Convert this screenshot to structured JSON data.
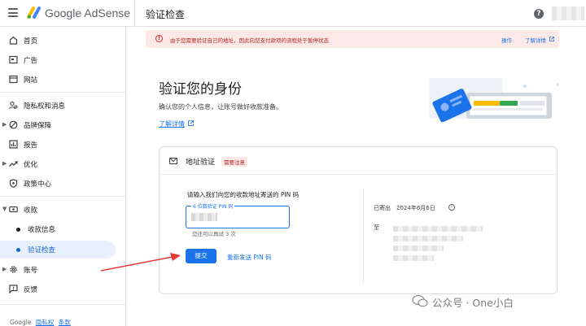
{
  "header": {
    "brand": "Google AdSense",
    "title": "验证检查",
    "help": "?"
  },
  "sidebar": {
    "items": [
      {
        "label": "首页"
      },
      {
        "label": "广告"
      },
      {
        "label": "网站"
      },
      {
        "label": "隐私权和消息"
      },
      {
        "label": "品牌保障"
      },
      {
        "label": "报告"
      },
      {
        "label": "优化"
      },
      {
        "label": "政策中心"
      },
      {
        "label": "收款"
      },
      {
        "label": "收款信息"
      },
      {
        "label": "验证检查"
      },
      {
        "label": "账号"
      },
      {
        "label": "反馈"
      }
    ],
    "footer": {
      "google": "Google",
      "privacy": "隐私权",
      "terms": "条款"
    }
  },
  "banner": {
    "message": "由于您需要验证自己的地址，因此向您支付款项的流程处于暂停状态",
    "action": "操作",
    "details": "了解详情"
  },
  "main": {
    "heading": "验证您的身份",
    "description": "确认您的个人信息，让账号做好收款准备。",
    "learn_more": "了解详情"
  },
  "card": {
    "title": "地址验证",
    "badge": "需要注意",
    "prompt": "请输入我们向您的收款地址寄送的 PIN 码",
    "pin_label": "6 位数验证 PIN 码",
    "attempts": "您还可以再试 3 次",
    "submit": "提交",
    "resend": "重新发送 PIN 码",
    "sent_label": "已寄出",
    "sent_date": "2024年6月6日",
    "to_label": "至"
  },
  "watermark": "公众号 · One小白",
  "colors": {
    "accent": "#1a73e8",
    "warning": "#d93025",
    "banner_bg": "#fce8e6",
    "arrow": "#e53935"
  }
}
